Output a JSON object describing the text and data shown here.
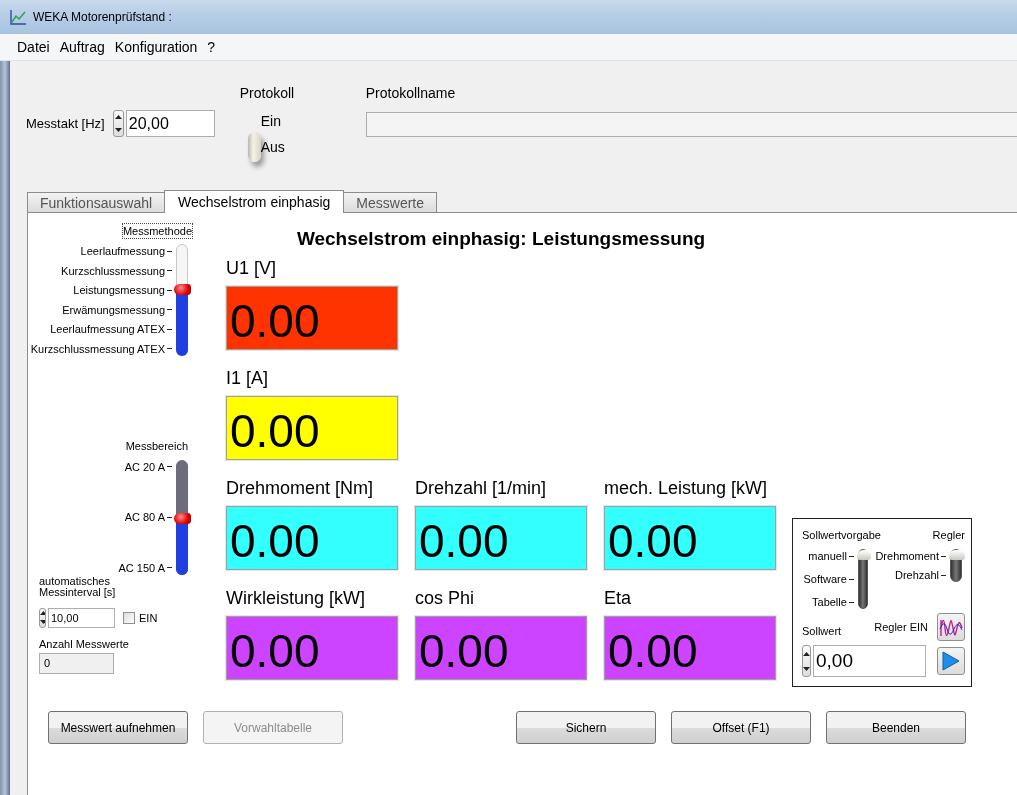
{
  "window": {
    "title": "WEKA Motorenprüfstand :"
  },
  "menu": [
    "Datei",
    "Auftrag",
    "Konfiguration",
    "?"
  ],
  "messtakt": {
    "label": "Messtakt [Hz]",
    "value": "20,00"
  },
  "protokoll": {
    "label": "Protokoll",
    "on_label": "Ein",
    "off_label": "Aus",
    "on": false
  },
  "protokollname": {
    "label": "Protokollname"
  },
  "tabs": [
    {
      "label": "Funktionsauswahl",
      "selected": false
    },
    {
      "label": "Wechselstrom einphasig",
      "selected": true
    },
    {
      "label": "Messwerte",
      "selected": false
    }
  ],
  "messmethode": {
    "label": "Messmethode",
    "options": [
      "Leerlaufmessung",
      "Kurzschlussmessung",
      "Leistungsmessung",
      "Erwämungsmessung",
      "Leerlaufmessung ATEX",
      "Kurzschlussmessung ATEX"
    ],
    "level": 0.6
  },
  "messbereich": {
    "label": "Messbereich",
    "options": [
      "AC 20 A",
      "AC 80 A",
      "AC 150 A"
    ],
    "level": 0.5
  },
  "auto_interval": {
    "label": "automatisches Messinterval [s]",
    "value": "10,00",
    "checkbox_label": "EIN",
    "checked": false
  },
  "anzahl_messwerte": {
    "label": "Anzahl Messwerte",
    "value": "0"
  },
  "heading": "Wechselstrom einphasig: Leistungsmessung",
  "displays": [
    [
      {
        "label": "U1 [V]",
        "value": "0.00",
        "color": "#ff3300"
      }
    ],
    [
      {
        "label": "I1 [A]",
        "value": "0.00",
        "color": "#ffff00"
      }
    ],
    [
      {
        "label": "Drehmoment [Nm]",
        "value": "0.00",
        "color": "#33ffff"
      },
      {
        "label": "Drehzahl [1/min]",
        "value": "0.00",
        "color": "#33ffff"
      },
      {
        "label": "mech. Leistung [kW]",
        "value": "0.00",
        "color": "#33ffff"
      }
    ],
    [
      {
        "label": "Wirkleistung [kW]",
        "value": "0.00",
        "color": "#cc44ff"
      },
      {
        "label": "cos Phi",
        "value": "0.00",
        "color": "#cc44ff"
      },
      {
        "label": "Eta",
        "value": "0.00",
        "color": "#cc44ff"
      }
    ]
  ],
  "controller": {
    "sollwertvorgabe": {
      "label": "Sollwertvorgabe",
      "options": [
        "manuell",
        "Software",
        "Tabelle"
      ],
      "level": 1
    },
    "regler": {
      "label": "Regler",
      "options": [
        "Drehmoment",
        "Drehzahl"
      ],
      "level": 1
    },
    "regler_ein": "Regler EIN",
    "sollwert": {
      "label": "Sollwert",
      "value": "0,00"
    }
  },
  "buttons_left": [
    {
      "label": "Messwert aufnehmen",
      "disabled": false
    },
    {
      "label": "Vorwahltabelle",
      "disabled": true
    }
  ],
  "buttons_right": [
    {
      "label": "Sichern",
      "disabled": false
    },
    {
      "label": "Offset (F1)",
      "disabled": false
    },
    {
      "label": "Beenden",
      "disabled": false
    }
  ]
}
